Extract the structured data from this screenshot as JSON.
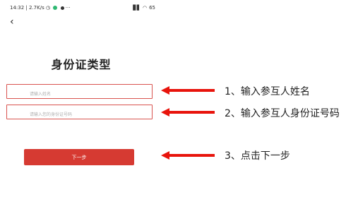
{
  "status_bar": {
    "time_speed": "14:32 | 2.7K/s",
    "more": "···",
    "signal": "▊▋",
    "wifi": "◠",
    "battery": "65"
  },
  "header": {
    "back_glyph": "‹"
  },
  "page": {
    "title": "身份证类型"
  },
  "form": {
    "name_placeholder": "请输入姓名",
    "name_value": "",
    "id_placeholder": "请输入您的身份证号码",
    "id_value": "",
    "next_label": "下一步"
  },
  "annotations": {
    "step1": "1、输入参互人姓名",
    "step2": "2、输入参互人身份证号码",
    "step3": "3、点击下一步",
    "arrow_color": "#e8140c"
  },
  "theme": {
    "accent": "#d63a32",
    "input_border": "#d9534f"
  }
}
